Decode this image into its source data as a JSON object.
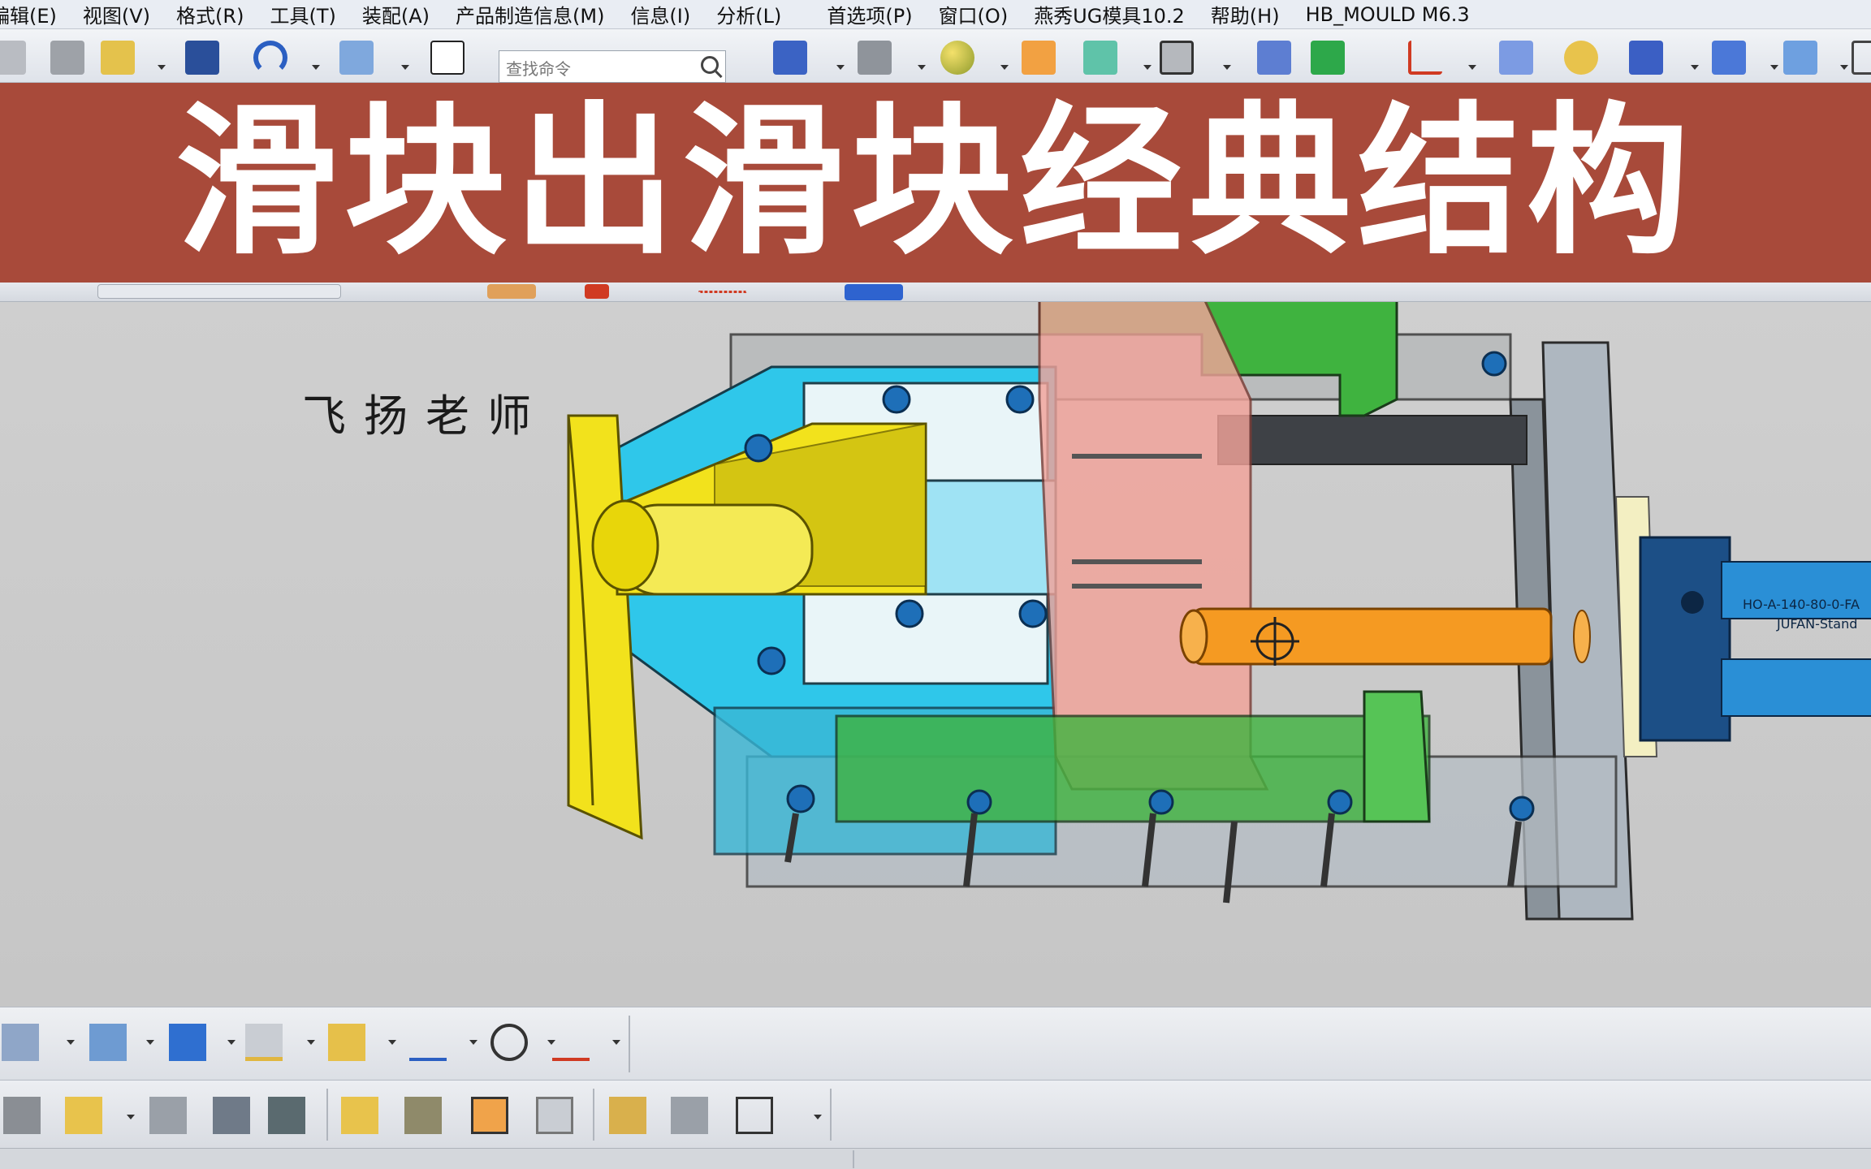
{
  "menu": {
    "items": [
      "编辑(E)",
      "视图(V)",
      "格式(R)",
      "工具(T)",
      "装配(A)",
      "产品制造信息(M)",
      "信息(I)",
      "分析(L)",
      "首选项(P)",
      "窗口(O)",
      "燕秀UG模具10.2",
      "帮助(H)",
      "HB_MOULD M6.3"
    ]
  },
  "toolbar": {
    "search_placeholder": "查找命令"
  },
  "banner": {
    "title": "滑块出滑块经典结构"
  },
  "viewport": {
    "watermark": "飞扬老师",
    "cylinder_label": "HO-A-140-80-0-FA",
    "cylinder_brand": "JUFAN-Stand"
  },
  "colors": {
    "banner": "#a84a3a",
    "yellow_slider": "#f2e21c",
    "cyan_block": "#2fc7ea",
    "pink_plate": "#f2a39a",
    "green_block": "#3fb33f",
    "orange_rod": "#f59a22",
    "cylinder_blue": "#1c4f86"
  }
}
